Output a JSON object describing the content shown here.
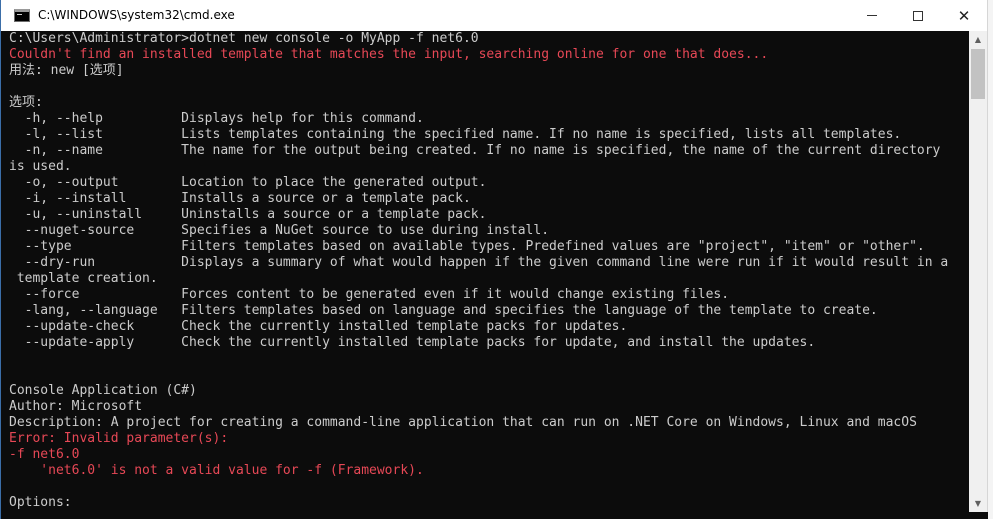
{
  "window": {
    "title": "C:\\WINDOWS\\system32\\cmd.exe",
    "minimize_glyph": "—",
    "maximize_glyph": "☐",
    "close_glyph": "✕"
  },
  "colors": {
    "console_bg": "#0c0c0c",
    "console_text": "#cccccc",
    "error_text": "#e74856"
  },
  "console": {
    "lines": [
      {
        "text": "C:\\Users\\Administrator>dotnet new console -o MyApp -f net6.0",
        "style": "normal"
      },
      {
        "text": "Couldn't find an installed template that matches the input, searching online for one that does...",
        "style": "error"
      },
      {
        "text": "用法: new [选项]",
        "style": "normal"
      },
      {
        "text": "",
        "style": "normal"
      },
      {
        "text": "选项:",
        "style": "normal"
      },
      {
        "text": "  -h, --help          Displays help for this command.",
        "style": "normal"
      },
      {
        "text": "  -l, --list          Lists templates containing the specified name. If no name is specified, lists all templates.",
        "style": "normal"
      },
      {
        "text": "  -n, --name          The name for the output being created. If no name is specified, the name of the current directory",
        "style": "normal"
      },
      {
        "text": "is used.",
        "style": "normal"
      },
      {
        "text": "  -o, --output        Location to place the generated output.",
        "style": "normal"
      },
      {
        "text": "  -i, --install       Installs a source or a template pack.",
        "style": "normal"
      },
      {
        "text": "  -u, --uninstall     Uninstalls a source or a template pack.",
        "style": "normal"
      },
      {
        "text": "  --nuget-source      Specifies a NuGet source to use during install.",
        "style": "normal"
      },
      {
        "text": "  --type              Filters templates based on available types. Predefined values are \"project\", \"item\" or \"other\".",
        "style": "normal"
      },
      {
        "text": "  --dry-run           Displays a summary of what would happen if the given command line were run if it would result in a",
        "style": "normal"
      },
      {
        "text": " template creation.",
        "style": "normal"
      },
      {
        "text": "  --force             Forces content to be generated even if it would change existing files.",
        "style": "normal"
      },
      {
        "text": "  -lang, --language   Filters templates based on language and specifies the language of the template to create.",
        "style": "normal"
      },
      {
        "text": "  --update-check      Check the currently installed template packs for updates.",
        "style": "normal"
      },
      {
        "text": "  --update-apply      Check the currently installed template packs for update, and install the updates.",
        "style": "normal"
      },
      {
        "text": "",
        "style": "normal"
      },
      {
        "text": "",
        "style": "normal"
      },
      {
        "text": "Console Application (C#)",
        "style": "normal"
      },
      {
        "text": "Author: Microsoft",
        "style": "normal"
      },
      {
        "text": "Description: A project for creating a command-line application that can run on .NET Core on Windows, Linux and macOS",
        "style": "normal"
      },
      {
        "text": "Error: Invalid parameter(s):",
        "style": "error"
      },
      {
        "text": "-f net6.0",
        "style": "error"
      },
      {
        "text": "    'net6.0' is not a valid value for -f (Framework).",
        "style": "error"
      },
      {
        "text": "",
        "style": "normal"
      },
      {
        "text": "Options:",
        "style": "normal"
      }
    ]
  },
  "scrollbar": {
    "up_glyph": "▲",
    "down_glyph": "▼"
  }
}
